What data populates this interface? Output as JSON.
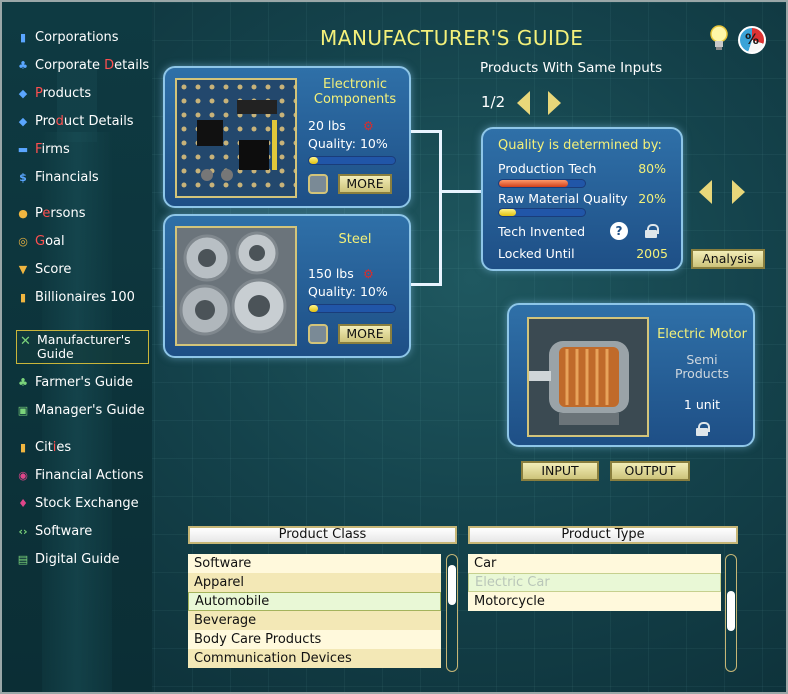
{
  "header": {
    "title": "MANUFACTURER'S GUIDE"
  },
  "sidebar": {
    "items": [
      {
        "pre": "",
        "hl": "",
        "post": "Corporations",
        "icon": "building-icon",
        "color": "#5aa6ff",
        "glyph": "▮"
      },
      {
        "pre": "Corporate ",
        "hl": "D",
        "post": "etails",
        "icon": "org-chart-icon",
        "color": "#5aa6ff",
        "glyph": "♣"
      },
      {
        "pre": "",
        "hl": "P",
        "post": "roducts",
        "icon": "cube-icon",
        "color": "#5aa6ff",
        "glyph": "◆"
      },
      {
        "pre": "Pro",
        "hl": "d",
        "post": "uct Details",
        "icon": "tag-icon",
        "color": "#5aa6ff",
        "glyph": "◆"
      },
      {
        "pre": "",
        "hl": "F",
        "post": "irms",
        "icon": "car-icon",
        "color": "#5aa6ff",
        "glyph": "▬"
      },
      {
        "pre": "Financials",
        "hl": "",
        "post": "",
        "icon": "dollar-icon",
        "color": "#5aa6ff",
        "glyph": "$"
      },
      {
        "pre": "P",
        "hl": "e",
        "post": "rsons",
        "icon": "person-icon",
        "color": "#f0b640",
        "glyph": "●"
      },
      {
        "pre": "",
        "hl": "G",
        "post": "oal",
        "icon": "target-icon",
        "color": "#f0b640",
        "glyph": "◎"
      },
      {
        "pre": "Score",
        "hl": "",
        "post": "",
        "icon": "trophy-icon",
        "color": "#f0b640",
        "glyph": "▼"
      },
      {
        "pre": "Billionaires 100",
        "hl": "",
        "post": "",
        "icon": "bar-chart-icon",
        "color": "#f0b640",
        "glyph": "▮"
      },
      {
        "pre": "Farmer's Guide",
        "hl": "",
        "post": "",
        "icon": "plant-icon",
        "color": "#7bd37b",
        "glyph": "♣"
      },
      {
        "pre": "Manager's Guide",
        "hl": "",
        "post": "",
        "icon": "briefcase-icon",
        "color": "#7bd37b",
        "glyph": "▣"
      },
      {
        "pre": "Cit",
        "hl": "i",
        "post": "es",
        "icon": "city-icon",
        "color": "#f0b640",
        "glyph": "▮"
      },
      {
        "pre": "Financial Actions",
        "hl": "",
        "post": "",
        "icon": "finance-actions-icon",
        "color": "#e0468a",
        "glyph": "◉"
      },
      {
        "pre": "Stock Exchange",
        "hl": "",
        "post": "",
        "icon": "stock-exchange-icon",
        "color": "#e0468a",
        "glyph": "♦"
      },
      {
        "pre": "Software",
        "hl": "",
        "post": "",
        "icon": "code-icon",
        "color": "#7bd37b",
        "glyph": "‹›"
      },
      {
        "pre": "Digital Guide",
        "hl": "",
        "post": "",
        "icon": "book-icon",
        "color": "#7bd37b",
        "glyph": "▤"
      }
    ],
    "selected": {
      "line1": "Manufacturer's",
      "line2": "Guide"
    }
  },
  "inputs": [
    {
      "name": "Electronic Components",
      "name1": "Electronic",
      "name2": "Components",
      "qty": "20 lbs",
      "quality_label": "Quality: 10%",
      "quality": 0.1,
      "more": "MORE"
    },
    {
      "name": "Steel",
      "qty": "150 lbs",
      "quality_label": "Quality: 10%",
      "quality": 0.1,
      "more": "MORE"
    }
  ],
  "same_inputs": {
    "label": "Products With Same Inputs",
    "page": "1/2"
  },
  "quality_panel": {
    "caption": "Quality is determined by:",
    "production_tech": {
      "label": "Production Tech",
      "value": "80%",
      "level": 0.8
    },
    "raw_material": {
      "label": "Raw Material Quality",
      "value": "20%",
      "level": 0.2
    },
    "tech_invented": {
      "label": "Tech Invented",
      "help": "?"
    },
    "locked_until": {
      "label": "Locked Until",
      "value": "2005"
    },
    "analysis_button": "Analysis"
  },
  "product": {
    "name": "Electric Motor",
    "type1": "Semi",
    "type2": "Products",
    "qty": "1 unit"
  },
  "io_buttons": {
    "input": "INPUT",
    "output": "OUTPUT"
  },
  "product_class": {
    "header": "Product Class",
    "items": [
      "Software",
      "Apparel",
      "Automobile",
      "Beverage",
      "Body Care Products",
      "Communication Devices"
    ],
    "selected": "Automobile"
  },
  "product_type": {
    "header": "Product Type",
    "items": [
      "Car",
      "Electric Car",
      "Motorcycle"
    ],
    "selected": "Electric Car"
  },
  "colors": {
    "accent_yellow": "#f3f07a",
    "card_blue": "#2f70a8",
    "highlight_red": "#ff5050"
  }
}
